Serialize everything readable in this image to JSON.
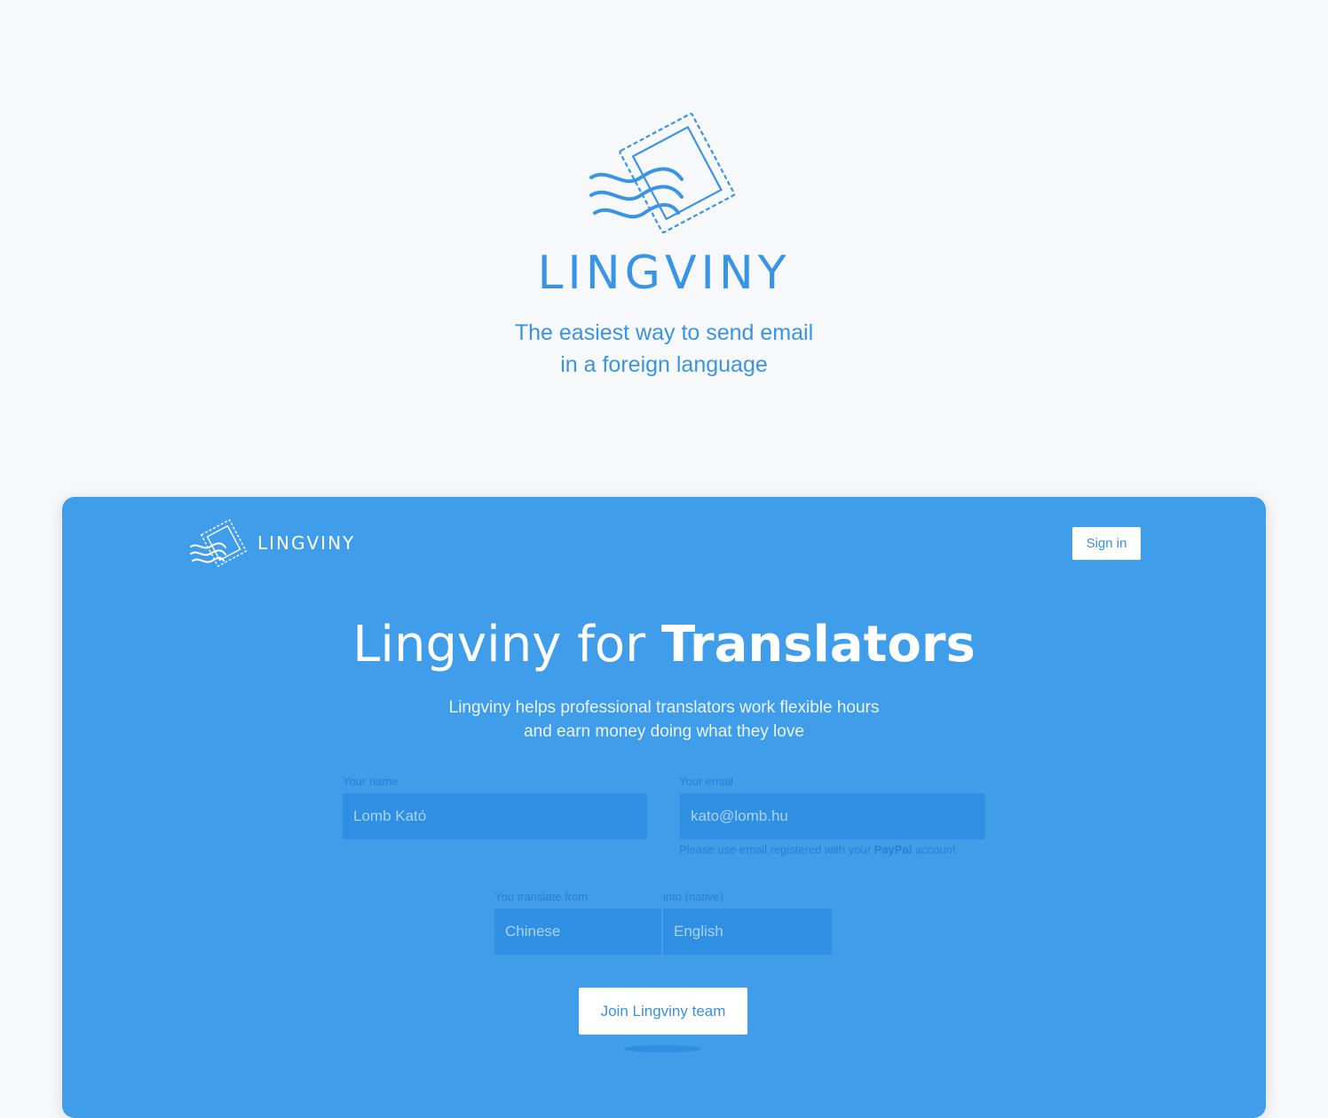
{
  "hero": {
    "brand": "LINGVINY",
    "tagline_line1": "The easiest way to send email",
    "tagline_line2": "in a foreign language",
    "logo_icon": "stamp-waves-icon",
    "accent_color": "#3a94e6"
  },
  "card": {
    "background_color": "#3f9dea",
    "nav": {
      "brand": "LINGVINY",
      "signin_label": "Sign in"
    },
    "headline_regular": "Lingviny for ",
    "headline_bold": "Translators",
    "sub_line1": "Lingviny helps professional translators work flexible hours",
    "sub_line2": "and earn money doing what they love",
    "form": {
      "name_label": "Your name",
      "name_placeholder": "Lomb Kató",
      "email_label": "Your email",
      "email_placeholder": "kato@lomb.hu",
      "email_hint_before": "Please use email registered with your ",
      "email_hint_bold": "PayPal",
      "email_hint_after": " account",
      "from_label": "You translate from",
      "from_value": "Chinese",
      "into_label": "into (native)",
      "into_value": "English",
      "join_label": "Join Lingviny team"
    }
  }
}
